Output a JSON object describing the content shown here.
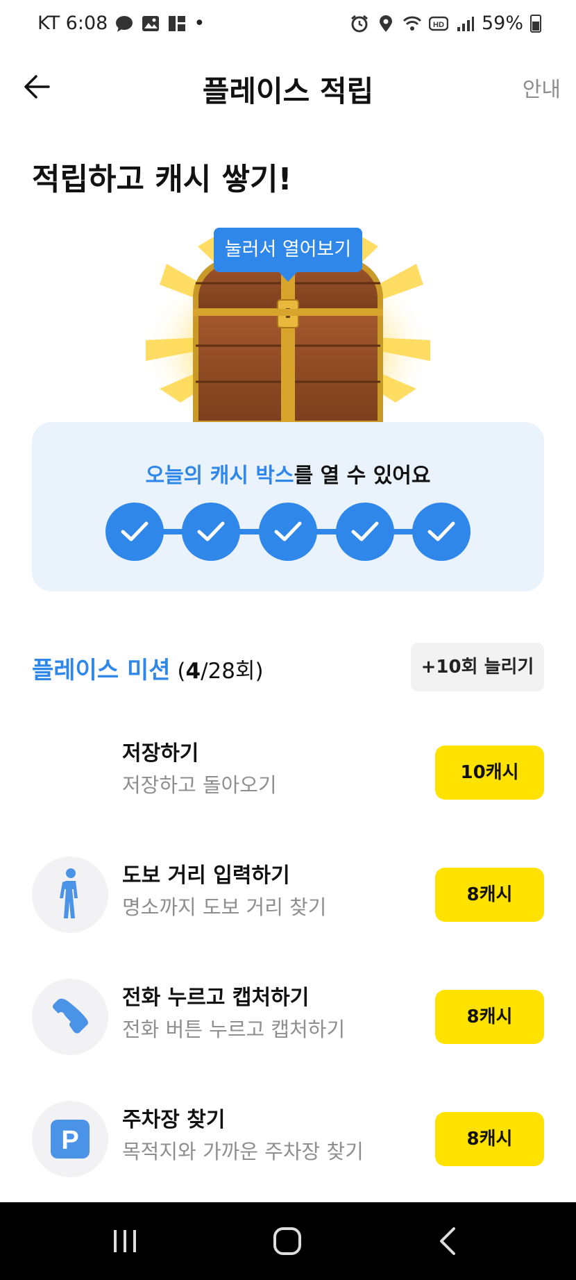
{
  "status_bar": {
    "carrier_time": "KT 6:08",
    "dot": "•",
    "battery_text": "59%"
  },
  "header": {
    "title": "플레이스 적립",
    "guide_label": "안내"
  },
  "headline": "적립하고 캐시 쌓기!",
  "treasure": {
    "tooltip": "눌러서 열어보기"
  },
  "progress_card": {
    "highlight": "오늘의 캐시 박스",
    "rest": "를 열 수 있어요",
    "completed_steps": 5,
    "total_steps": 5
  },
  "missions": {
    "title": "플레이스 미션",
    "count_open": " (",
    "count_done": "4",
    "count_total": "/28회)",
    "extend_label": "+10회 늘리기",
    "items": [
      {
        "title": "저장하기",
        "sub": "저장하고 돌아오기",
        "reward": "10캐시",
        "icon": "none"
      },
      {
        "title": "도보 거리 입력하기",
        "sub": "명소까지 도보 거리 찾기",
        "reward": "8캐시",
        "icon": "walking-person-icon"
      },
      {
        "title": "전화 누르고 캡처하기",
        "sub": "전화 버튼 누르고 캡처하기",
        "reward": "8캐시",
        "icon": "phone-icon"
      },
      {
        "title": "주차장 찾기",
        "sub": "목적지와 가까운 주차장 찾기",
        "reward": "8캐시",
        "icon": "parking-icon",
        "icon_letter": "P"
      }
    ]
  },
  "colors": {
    "accent": "#2f87ea",
    "reward": "#ffe200",
    "card_bg": "#eaf2fc"
  }
}
